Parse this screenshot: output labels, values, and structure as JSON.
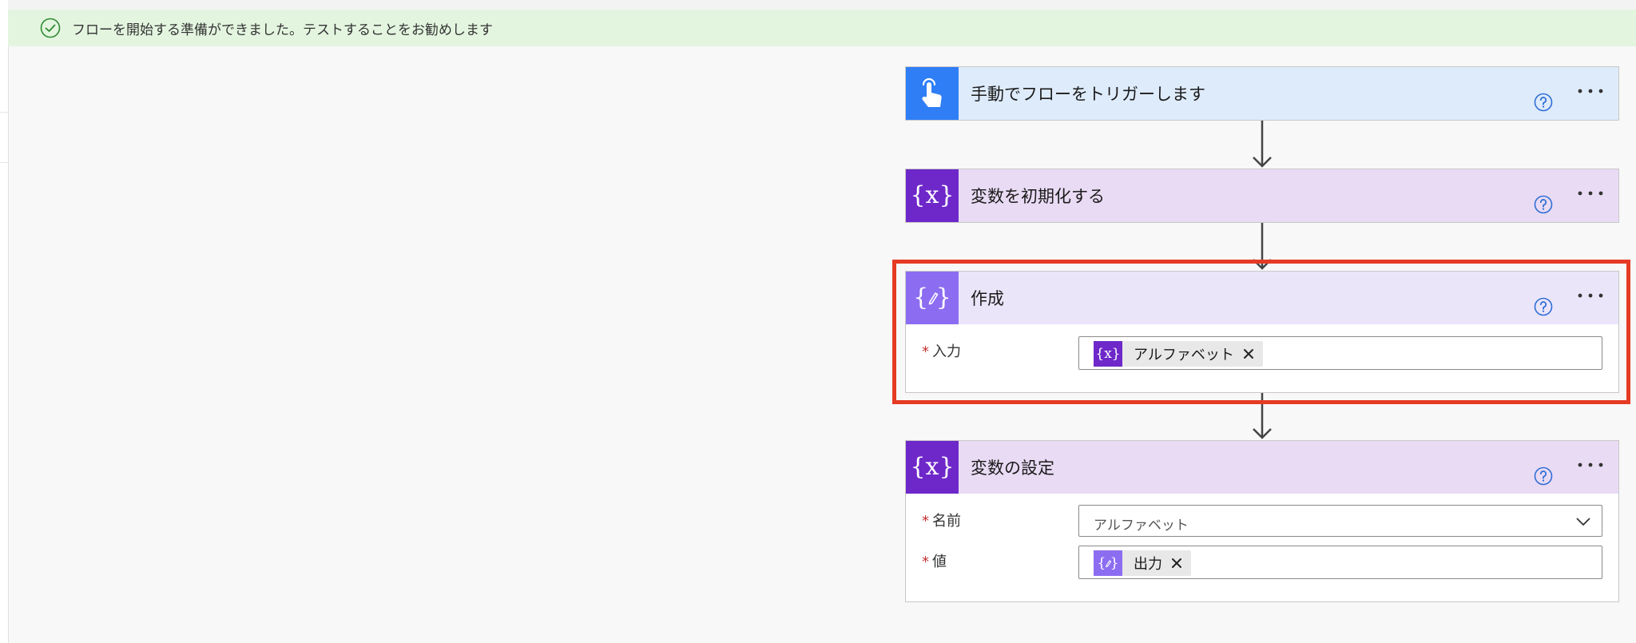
{
  "banner": {
    "message": "フローを開始する準備ができました。テストすることをお勧めします"
  },
  "steps": {
    "trigger": {
      "title": "手動でフローをトリガーします",
      "icon": "touch-hand-icon"
    },
    "init_variable": {
      "title": "変数を初期化する",
      "icon": "variable-icon"
    },
    "compose": {
      "title": "作成",
      "icon": "compose-icon",
      "input_label": "入力",
      "input_token": "アルファベット",
      "input_token_icon": "variable-icon"
    },
    "set_variable": {
      "title": "変数の設定",
      "icon": "variable-icon",
      "name_label": "名前",
      "name_value": "アルファベット",
      "value_label": "値",
      "value_token": "出力",
      "value_token_icon": "compose-icon"
    }
  },
  "required_marker": "*",
  "colors": {
    "banner_bg": "#e3f5df",
    "trigger_blue": "#2f7ef6",
    "variable_purple": "#6e28c9",
    "compose_purple": "#8c6df1",
    "highlight_red": "#e53b24"
  }
}
